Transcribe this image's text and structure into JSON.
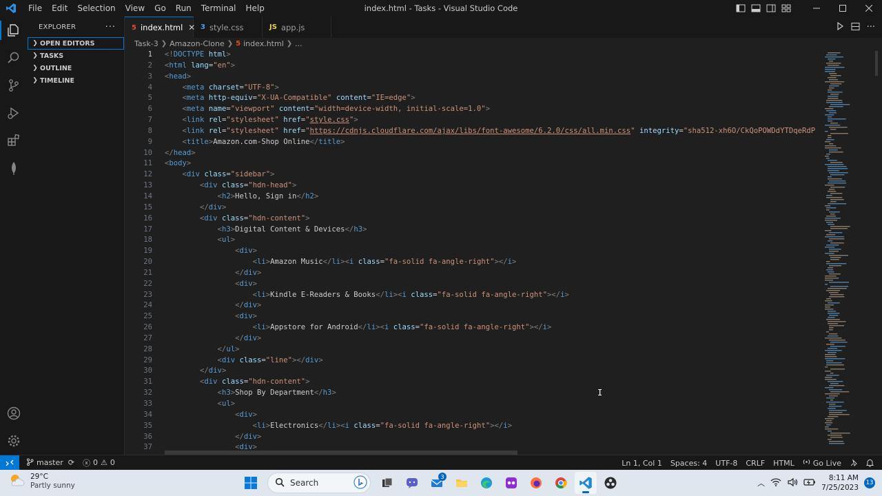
{
  "titlebar": {
    "menu": [
      "File",
      "Edit",
      "Selection",
      "View",
      "Go",
      "Run",
      "Terminal",
      "Help"
    ],
    "title": "index.html - Tasks - Visual Studio Code"
  },
  "sidebar": {
    "header": "EXPLORER",
    "sections": [
      "OPEN EDITORS",
      "TASKS",
      "OUTLINE",
      "TIMELINE"
    ]
  },
  "tabs": [
    {
      "label": "index.html",
      "icon": "html-file-icon",
      "active": true
    },
    {
      "label": "style.css",
      "icon": "css-file-icon",
      "active": false
    },
    {
      "label": "app.js",
      "icon": "js-file-icon",
      "active": false
    }
  ],
  "breadcrumbs": [
    "Task-3",
    "Amazon-Clone",
    "index.html",
    "..."
  ],
  "code": {
    "current_line": 1,
    "lines": [
      {
        "n": "1",
        "html": "<span class='br'>&lt;!</span><span class='tag'>DOCTYPE</span> <span class='attr'>html</span><span class='br'>&gt;</span>"
      },
      {
        "n": "2",
        "html": "<span class='br'>&lt;</span><span class='tag'>html</span> <span class='attr'>lang</span>=<span class='str'>\"en\"</span><span class='br'>&gt;</span>"
      },
      {
        "n": "3",
        "html": "<span class='br'>&lt;</span><span class='tag'>head</span><span class='br'>&gt;</span>"
      },
      {
        "n": "4",
        "html": "    <span class='br'>&lt;</span><span class='tag'>meta</span> <span class='attr'>charset</span>=<span class='str'>\"UTF-8\"</span><span class='br'>&gt;</span>"
      },
      {
        "n": "5",
        "html": "    <span class='br'>&lt;</span><span class='tag'>meta</span> <span class='attr'>http-equiv</span>=<span class='str'>\"X-UA-Compatible\"</span> <span class='attr'>content</span>=<span class='str'>\"IE=edge\"</span><span class='br'>&gt;</span>"
      },
      {
        "n": "6",
        "html": "    <span class='br'>&lt;</span><span class='tag'>meta</span> <span class='attr'>name</span>=<span class='str'>\"viewport\"</span> <span class='attr'>content</span>=<span class='str'>\"width=device-width, initial-scale=1.0\"</span><span class='br'>&gt;</span>"
      },
      {
        "n": "7",
        "html": "    <span class='br'>&lt;</span><span class='tag'>link</span> <span class='attr'>rel</span>=<span class='str'>\"stylesheet\"</span> <span class='attr'>href</span>=<span class='str'>\"</span><span class='link'>style.css</span><span class='str'>\"</span><span class='br'>&gt;</span>"
      },
      {
        "n": "8",
        "html": "    <span class='br'>&lt;</span><span class='tag'>link</span> <span class='attr'>rel</span>=<span class='str'>\"stylesheet\"</span> <span class='attr'>href</span>=<span class='str'>\"</span><span class='link'>https://cdnjs.cloudflare.com/ajax/libs/font-awesome/6.2.0/css/all.min.css</span><span class='str'>\"</span> <span class='attr'>integrity</span>=<span class='str'>\"sha512-xh6O/CkQoPOWDdYTDqeRdP</span>"
      },
      {
        "n": "9",
        "html": "    <span class='br'>&lt;</span><span class='tag'>title</span><span class='br'>&gt;</span>Amazon.com-Shop Online<span class='br'>&lt;/</span><span class='tag'>title</span><span class='br'>&gt;</span>"
      },
      {
        "n": "10",
        "html": "<span class='br'>&lt;/</span><span class='tag'>head</span><span class='br'>&gt;</span>"
      },
      {
        "n": "11",
        "html": "<span class='br'>&lt;</span><span class='tag'>body</span><span class='br'>&gt;</span>"
      },
      {
        "n": "12",
        "html": "    <span class='br'>&lt;</span><span class='tag'>div</span> <span class='attr'>class</span>=<span class='str'>\"sidebar\"</span><span class='br'>&gt;</span>"
      },
      {
        "n": "13",
        "html": "        <span class='br'>&lt;</span><span class='tag'>div</span> <span class='attr'>class</span>=<span class='str'>\"hdn-head\"</span><span class='br'>&gt;</span>"
      },
      {
        "n": "14",
        "html": "            <span class='br'>&lt;</span><span class='tag'>h2</span><span class='br'>&gt;</span>Hello, Sign in<span class='br'>&lt;/</span><span class='tag'>h2</span><span class='br'>&gt;</span>"
      },
      {
        "n": "15",
        "html": "        <span class='br'>&lt;/</span><span class='tag'>div</span><span class='br'>&gt;</span>"
      },
      {
        "n": "16",
        "html": "        <span class='br'>&lt;</span><span class='tag'>div</span> <span class='attr'>class</span>=<span class='str'>\"hdn-content\"</span><span class='br'>&gt;</span>"
      },
      {
        "n": "17",
        "html": "            <span class='br'>&lt;</span><span class='tag'>h3</span><span class='br'>&gt;</span>Digital Content &amp; Devices<span class='br'>&lt;/</span><span class='tag'>h3</span><span class='br'>&gt;</span>"
      },
      {
        "n": "18",
        "html": "            <span class='br'>&lt;</span><span class='tag'>ul</span><span class='br'>&gt;</span>"
      },
      {
        "n": "19",
        "html": "                <span class='br'>&lt;</span><span class='tag'>div</span><span class='br'>&gt;</span>"
      },
      {
        "n": "20",
        "html": "                    <span class='br'>&lt;</span><span class='tag'>li</span><span class='br'>&gt;</span>Amazon Music<span class='br'>&lt;/</span><span class='tag'>li</span><span class='br'>&gt;&lt;</span><span class='tag'>i</span> <span class='attr'>class</span>=<span class='str'>\"fa-solid fa-angle-right\"</span><span class='br'>&gt;&lt;/</span><span class='tag'>i</span><span class='br'>&gt;</span>"
      },
      {
        "n": "21",
        "html": "                <span class='br'>&lt;/</span><span class='tag'>div</span><span class='br'>&gt;</span>"
      },
      {
        "n": "22",
        "html": "                <span class='br'>&lt;</span><span class='tag'>div</span><span class='br'>&gt;</span>"
      },
      {
        "n": "23",
        "html": "                    <span class='br'>&lt;</span><span class='tag'>li</span><span class='br'>&gt;</span>Kindle E-Readers &amp; Books<span class='br'>&lt;/</span><span class='tag'>li</span><span class='br'>&gt;&lt;</span><span class='tag'>i</span> <span class='attr'>class</span>=<span class='str'>\"fa-solid fa-angle-right\"</span><span class='br'>&gt;&lt;/</span><span class='tag'>i</span><span class='br'>&gt;</span>"
      },
      {
        "n": "24",
        "html": "                <span class='br'>&lt;/</span><span class='tag'>div</span><span class='br'>&gt;</span>"
      },
      {
        "n": "25",
        "html": "                <span class='br'>&lt;</span><span class='tag'>div</span><span class='br'>&gt;</span>"
      },
      {
        "n": "26",
        "html": "                    <span class='br'>&lt;</span><span class='tag'>li</span><span class='br'>&gt;</span>Appstore for Android<span class='br'>&lt;/</span><span class='tag'>li</span><span class='br'>&gt;&lt;</span><span class='tag'>i</span> <span class='attr'>class</span>=<span class='str'>\"fa-solid fa-angle-right\"</span><span class='br'>&gt;&lt;/</span><span class='tag'>i</span><span class='br'>&gt;</span>"
      },
      {
        "n": "27",
        "html": "                <span class='br'>&lt;/</span><span class='tag'>div</span><span class='br'>&gt;</span>"
      },
      {
        "n": "28",
        "html": "            <span class='br'>&lt;/</span><span class='tag'>ul</span><span class='br'>&gt;</span>"
      },
      {
        "n": "29",
        "html": "            <span class='br'>&lt;</span><span class='tag'>div</span> <span class='attr'>class</span>=<span class='str'>\"line\"</span><span class='br'>&gt;&lt;/</span><span class='tag'>div</span><span class='br'>&gt;</span>"
      },
      {
        "n": "30",
        "html": "        <span class='br'>&lt;/</span><span class='tag'>div</span><span class='br'>&gt;</span>"
      },
      {
        "n": "31",
        "html": "        <span class='br'>&lt;</span><span class='tag'>div</span> <span class='attr'>class</span>=<span class='str'>\"hdn-content\"</span><span class='br'>&gt;</span>"
      },
      {
        "n": "32",
        "html": "            <span class='br'>&lt;</span><span class='tag'>h3</span><span class='br'>&gt;</span>Shop By Department<span class='br'>&lt;/</span><span class='tag'>h3</span><span class='br'>&gt;</span>"
      },
      {
        "n": "33",
        "html": "            <span class='br'>&lt;</span><span class='tag'>ul</span><span class='br'>&gt;</span>"
      },
      {
        "n": "34",
        "html": "                <span class='br'>&lt;</span><span class='tag'>div</span><span class='br'>&gt;</span>"
      },
      {
        "n": "35",
        "html": "                    <span class='br'>&lt;</span><span class='tag'>li</span><span class='br'>&gt;</span>Electronics<span class='br'>&lt;/</span><span class='tag'>li</span><span class='br'>&gt;&lt;</span><span class='tag'>i</span> <span class='attr'>class</span>=<span class='str'>\"fa-solid fa-angle-right\"</span><span class='br'>&gt;&lt;/</span><span class='tag'>i</span><span class='br'>&gt;</span>"
      },
      {
        "n": "36",
        "html": "                <span class='br'>&lt;/</span><span class='tag'>div</span><span class='br'>&gt;</span>"
      },
      {
        "n": "37",
        "html": "                <span class='br'>&lt;</span><span class='tag'>div</span><span class='br'>&gt;</span>"
      }
    ]
  },
  "statusbar": {
    "branch": "master",
    "errors": "0",
    "warnings": "0",
    "position": "Ln 1, Col 1",
    "spaces": "Spaces: 4",
    "encoding": "UTF-8",
    "eol": "CRLF",
    "language": "HTML",
    "golive": "Go Live"
  },
  "taskbar": {
    "temperature": "29°C",
    "weather": "Partly sunny",
    "search_placeholder": "Search",
    "mail_badge": "3",
    "time": "8:11 AM",
    "date": "7/25/2023",
    "notifications": "13"
  },
  "colors": {
    "accent": "#0078d4",
    "tag": "#569cd6",
    "attribute": "#9cdcfe",
    "string": "#ce9178"
  }
}
